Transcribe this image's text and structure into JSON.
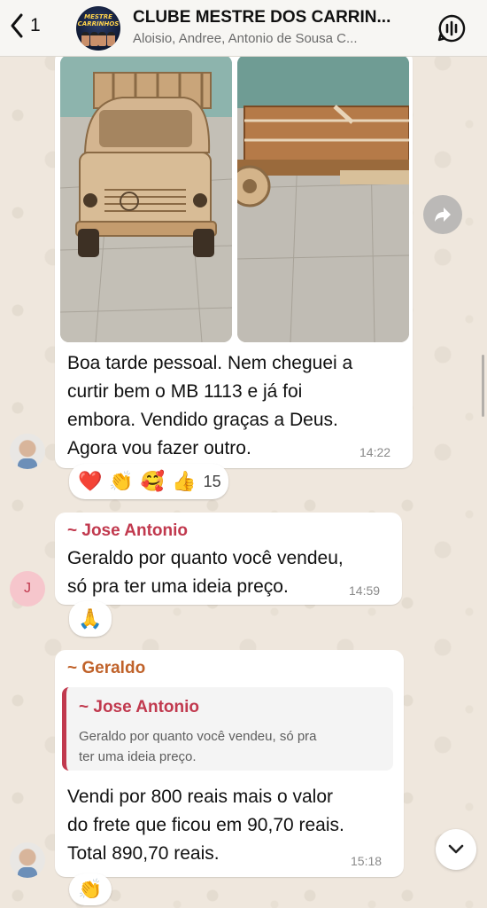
{
  "header": {
    "back_count": "1",
    "group_title": "CLUBE MESTRE DOS CARRIN...",
    "group_members": "Aloisio, Andree, Antonio de Sousa C...",
    "avatar_text": "MESTRE CARRINHOS"
  },
  "messages": [
    {
      "text_lines": [
        "Boa tarde pessoal.  Nem cheguei a",
        "curtir bem o MB 1113 e já foi",
        "embora. Vendido graças a Deus.",
        "Agora vou fazer outro."
      ],
      "time": "14:22",
      "reactions": [
        "❤️",
        "👏",
        "🥰",
        "👍"
      ],
      "reaction_count": "15"
    },
    {
      "sender": "~ Jose Antonio",
      "text_lines": [
        "Geraldo por quanto você vendeu,",
        "só pra ter uma ideia preço."
      ],
      "time": "14:59",
      "avatar_letter": "J",
      "reactions": [
        "🙏"
      ]
    },
    {
      "sender": "~ Geraldo",
      "quote": {
        "sender": "~ Jose Antonio",
        "text_lines": [
          "Geraldo por quanto você vendeu, só pra",
          "ter uma ideia preço."
        ]
      },
      "text_lines": [
        "Vendi por 800 reais mais o valor",
        "do frete que ficou em 90,70 reais.",
        "Total 890,70 reais."
      ],
      "time": "15:18",
      "reactions": [
        "👏"
      ]
    }
  ],
  "colors": {
    "jose_name": "#c1394e",
    "geraldo_name": "#c0622a",
    "header_bg": "#f7f6f3",
    "chat_bg": "#efe7dd"
  }
}
